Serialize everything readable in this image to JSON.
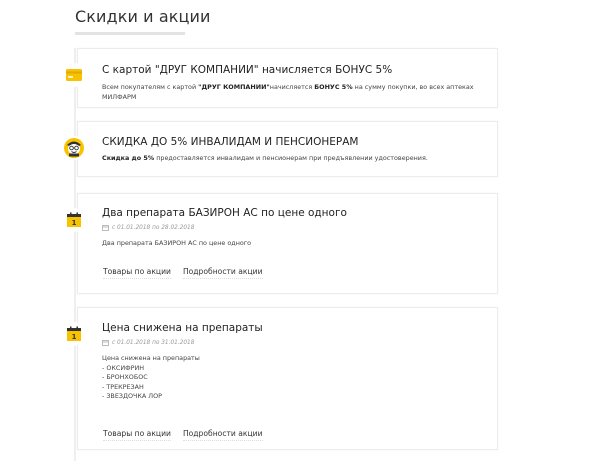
{
  "page": {
    "title": "Скидки и акции"
  },
  "promos": [
    {
      "icon": "bonus-card-icon",
      "title": "С картой \"ДРУГ КОМПАНИИ\" начисляется БОНУС 5%",
      "text_prefix": "Всем покупателям с картой ",
      "text_bold1": "\"ДРУГ КОМПАНИИ\"",
      "text_mid": "начисляется ",
      "text_bold2": "БОНУС 5%",
      "text_suffix": " на сумму покупки, во всех аптеках",
      "text_line2": "МИЛФАРМ"
    },
    {
      "icon": "senior-person-icon",
      "title": "СКИДКА ДО 5% ИНВАЛИДАМ И ПЕНСИОНЕРАМ",
      "text_bold": "Скидка до 5%",
      "text_rest": " предоставляется инвалидам и пенсионерам при предъявлении удостоверения."
    },
    {
      "icon": "calendar-icon",
      "calendar_day": "1",
      "title": "Два препарата БАЗИРОН АС по цене одного",
      "date": "с 01.01.2018 по 28.02.2018",
      "description": "Два препарата БАЗИРОН АС по цене одного",
      "link_products": "Товары по акции",
      "link_details": "Подробности акции"
    },
    {
      "icon": "calendar-icon",
      "calendar_day": "1",
      "title": "Цена снижена на препараты",
      "date": "с 01.01.2018 по 31.01.2018",
      "description_lines": [
        "Цена снижена на препараты",
        "- ОКСИФРИН",
        "- БРОНХОБОС",
        "- ТРЕКРЕЗАН",
        "- ЗВЕЗДОЧКА ЛОР"
      ],
      "link_products": "Товары по акции",
      "link_details": "Подробности акции"
    }
  ],
  "colors": {
    "accent_yellow": "#f7c200",
    "link_border": "#dddddd",
    "card_border": "#ececec"
  }
}
